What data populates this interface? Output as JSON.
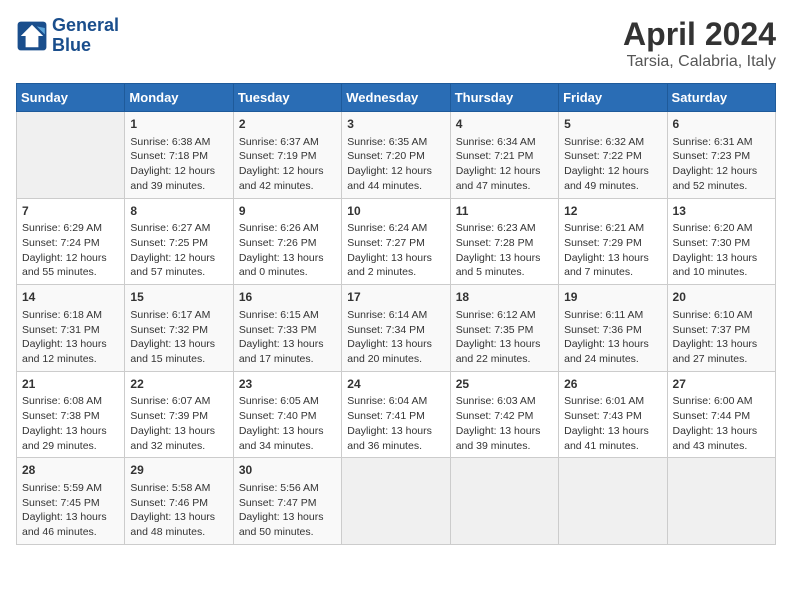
{
  "header": {
    "logo_line1": "General",
    "logo_line2": "Blue",
    "title": "April 2024",
    "subtitle": "Tarsia, Calabria, Italy"
  },
  "days_of_week": [
    "Sunday",
    "Monday",
    "Tuesday",
    "Wednesday",
    "Thursday",
    "Friday",
    "Saturday"
  ],
  "weeks": [
    [
      {
        "day": "",
        "info": ""
      },
      {
        "day": "1",
        "info": "Sunrise: 6:38 AM\nSunset: 7:18 PM\nDaylight: 12 hours\nand 39 minutes."
      },
      {
        "day": "2",
        "info": "Sunrise: 6:37 AM\nSunset: 7:19 PM\nDaylight: 12 hours\nand 42 minutes."
      },
      {
        "day": "3",
        "info": "Sunrise: 6:35 AM\nSunset: 7:20 PM\nDaylight: 12 hours\nand 44 minutes."
      },
      {
        "day": "4",
        "info": "Sunrise: 6:34 AM\nSunset: 7:21 PM\nDaylight: 12 hours\nand 47 minutes."
      },
      {
        "day": "5",
        "info": "Sunrise: 6:32 AM\nSunset: 7:22 PM\nDaylight: 12 hours\nand 49 minutes."
      },
      {
        "day": "6",
        "info": "Sunrise: 6:31 AM\nSunset: 7:23 PM\nDaylight: 12 hours\nand 52 minutes."
      }
    ],
    [
      {
        "day": "7",
        "info": "Sunrise: 6:29 AM\nSunset: 7:24 PM\nDaylight: 12 hours\nand 55 minutes."
      },
      {
        "day": "8",
        "info": "Sunrise: 6:27 AM\nSunset: 7:25 PM\nDaylight: 12 hours\nand 57 minutes."
      },
      {
        "day": "9",
        "info": "Sunrise: 6:26 AM\nSunset: 7:26 PM\nDaylight: 13 hours\nand 0 minutes."
      },
      {
        "day": "10",
        "info": "Sunrise: 6:24 AM\nSunset: 7:27 PM\nDaylight: 13 hours\nand 2 minutes."
      },
      {
        "day": "11",
        "info": "Sunrise: 6:23 AM\nSunset: 7:28 PM\nDaylight: 13 hours\nand 5 minutes."
      },
      {
        "day": "12",
        "info": "Sunrise: 6:21 AM\nSunset: 7:29 PM\nDaylight: 13 hours\nand 7 minutes."
      },
      {
        "day": "13",
        "info": "Sunrise: 6:20 AM\nSunset: 7:30 PM\nDaylight: 13 hours\nand 10 minutes."
      }
    ],
    [
      {
        "day": "14",
        "info": "Sunrise: 6:18 AM\nSunset: 7:31 PM\nDaylight: 13 hours\nand 12 minutes."
      },
      {
        "day": "15",
        "info": "Sunrise: 6:17 AM\nSunset: 7:32 PM\nDaylight: 13 hours\nand 15 minutes."
      },
      {
        "day": "16",
        "info": "Sunrise: 6:15 AM\nSunset: 7:33 PM\nDaylight: 13 hours\nand 17 minutes."
      },
      {
        "day": "17",
        "info": "Sunrise: 6:14 AM\nSunset: 7:34 PM\nDaylight: 13 hours\nand 20 minutes."
      },
      {
        "day": "18",
        "info": "Sunrise: 6:12 AM\nSunset: 7:35 PM\nDaylight: 13 hours\nand 22 minutes."
      },
      {
        "day": "19",
        "info": "Sunrise: 6:11 AM\nSunset: 7:36 PM\nDaylight: 13 hours\nand 24 minutes."
      },
      {
        "day": "20",
        "info": "Sunrise: 6:10 AM\nSunset: 7:37 PM\nDaylight: 13 hours\nand 27 minutes."
      }
    ],
    [
      {
        "day": "21",
        "info": "Sunrise: 6:08 AM\nSunset: 7:38 PM\nDaylight: 13 hours\nand 29 minutes."
      },
      {
        "day": "22",
        "info": "Sunrise: 6:07 AM\nSunset: 7:39 PM\nDaylight: 13 hours\nand 32 minutes."
      },
      {
        "day": "23",
        "info": "Sunrise: 6:05 AM\nSunset: 7:40 PM\nDaylight: 13 hours\nand 34 minutes."
      },
      {
        "day": "24",
        "info": "Sunrise: 6:04 AM\nSunset: 7:41 PM\nDaylight: 13 hours\nand 36 minutes."
      },
      {
        "day": "25",
        "info": "Sunrise: 6:03 AM\nSunset: 7:42 PM\nDaylight: 13 hours\nand 39 minutes."
      },
      {
        "day": "26",
        "info": "Sunrise: 6:01 AM\nSunset: 7:43 PM\nDaylight: 13 hours\nand 41 minutes."
      },
      {
        "day": "27",
        "info": "Sunrise: 6:00 AM\nSunset: 7:44 PM\nDaylight: 13 hours\nand 43 minutes."
      }
    ],
    [
      {
        "day": "28",
        "info": "Sunrise: 5:59 AM\nSunset: 7:45 PM\nDaylight: 13 hours\nand 46 minutes."
      },
      {
        "day": "29",
        "info": "Sunrise: 5:58 AM\nSunset: 7:46 PM\nDaylight: 13 hours\nand 48 minutes."
      },
      {
        "day": "30",
        "info": "Sunrise: 5:56 AM\nSunset: 7:47 PM\nDaylight: 13 hours\nand 50 minutes."
      },
      {
        "day": "",
        "info": ""
      },
      {
        "day": "",
        "info": ""
      },
      {
        "day": "",
        "info": ""
      },
      {
        "day": "",
        "info": ""
      }
    ]
  ]
}
